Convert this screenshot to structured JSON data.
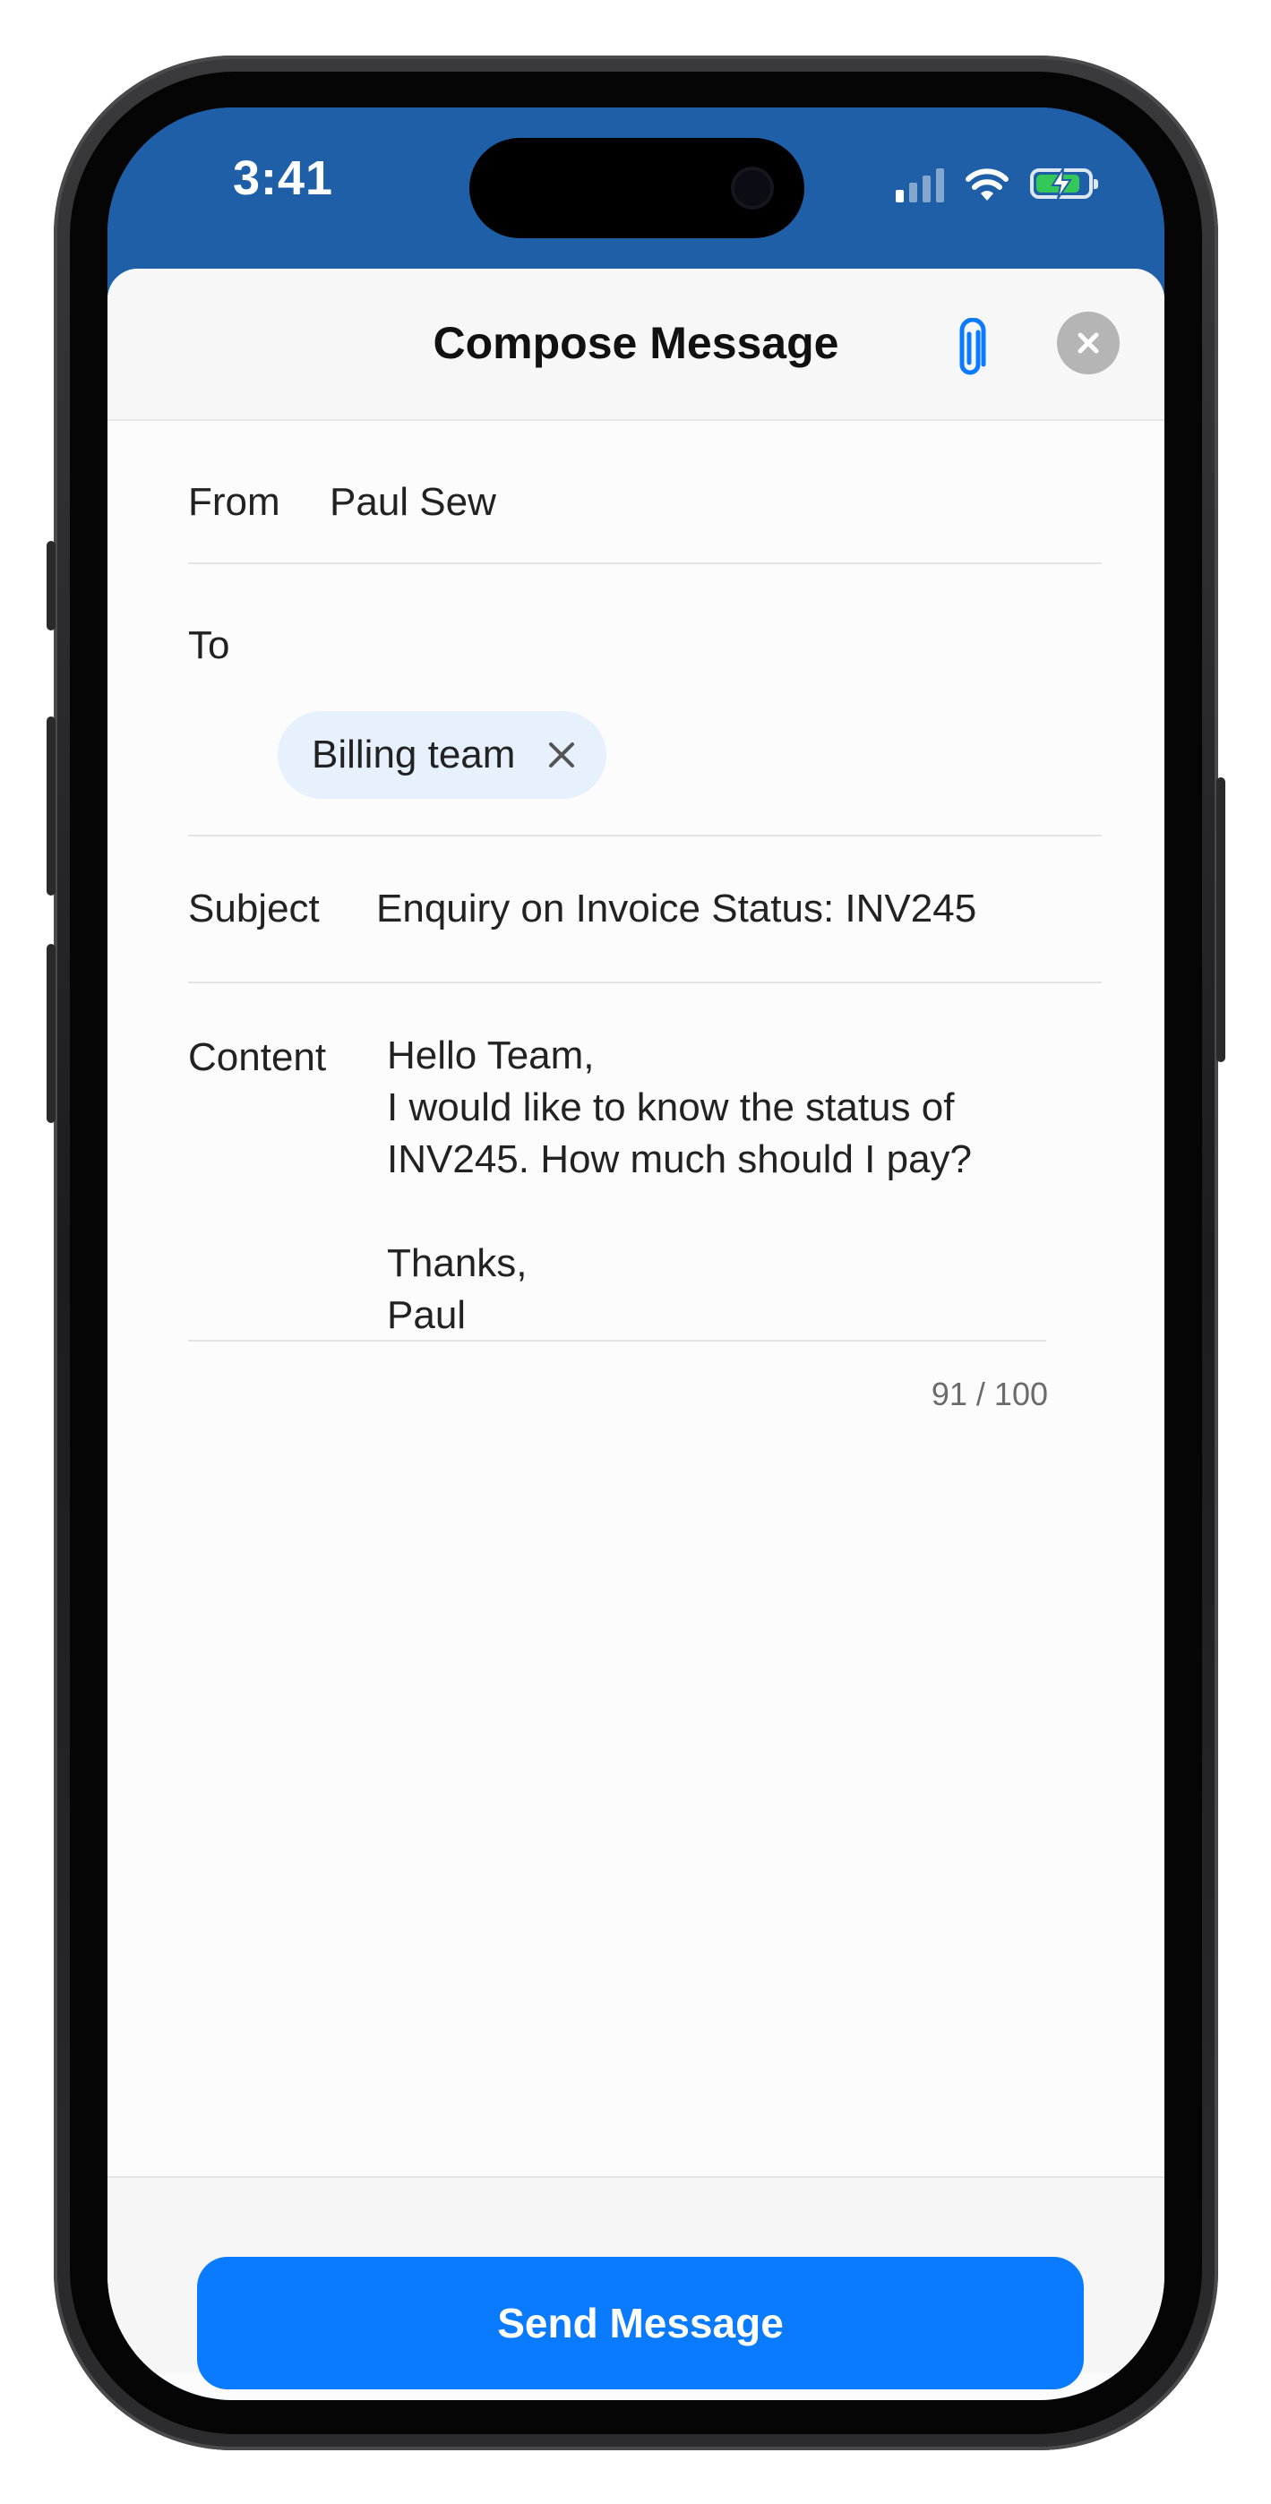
{
  "status_bar": {
    "time": "3:41"
  },
  "header": {
    "title": "Compose Message"
  },
  "form": {
    "from_label": "From",
    "from_value": "Paul Sew",
    "to_label": "To",
    "to_recipients": [
      "Billing team"
    ],
    "subject_label": "Subject",
    "subject_value": "Enquiry on Invoice Status: INV245",
    "content_label": "Content",
    "content_value": "Hello Team,\nI would like to know the status of\nINV245. How much should I pay?\n\nThanks,\nPaul",
    "char_count": "91 / 100"
  },
  "footer": {
    "send_label": "Send Message"
  },
  "icons": {
    "attach": "paperclip-icon",
    "close": "close-icon",
    "chip_remove": "x-icon",
    "signal": "cellular-signal-icon",
    "wifi": "wifi-icon",
    "battery": "battery-charging-icon"
  },
  "colors": {
    "status_bar_bg": "#1e5fa8",
    "accent": "#0a7aff",
    "chip_bg": "#e6f1fd",
    "battery_green": "#34c759"
  }
}
